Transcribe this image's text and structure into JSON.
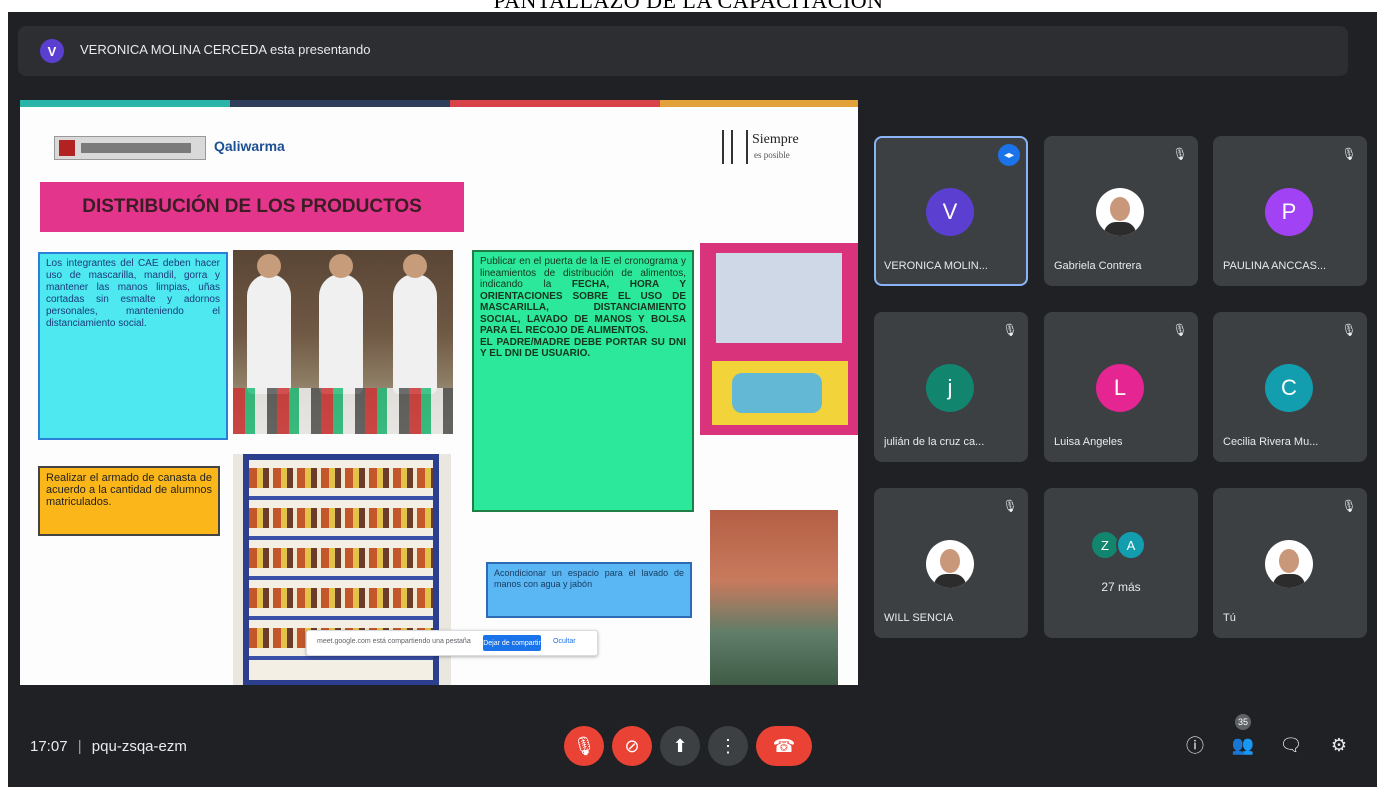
{
  "document": {
    "caption": "PANTALLAZO DE LA CAPACITACION"
  },
  "presenter": {
    "initial": "V",
    "text": "VERONICA MOLINA CERCEDA esta presentando"
  },
  "slide": {
    "stripe_colors": [
      "#2bb5a8",
      "#2f3e5a",
      "#d8434a",
      "#e3a13a"
    ],
    "logo_left_text": "Qaliwarma",
    "logo_right_text": "Siempre",
    "logo_right_sub": "es posible",
    "title": "DISTRIBUCIÓN DE LOS PRODUCTOS",
    "cyan_text": "Los integrantes del CAE deben hacer uso de mascarilla, mandil, gorra y mantener las manos limpias, uñas cortadas sin esmalte y adornos personales, manteniendo el distanciamiento social.",
    "orange_text": "Realizar el armado de canasta de acuerdo a la cantidad de alumnos matriculados.",
    "green_parts": {
      "p1": "Publicar en el puerta de la IE el cronograma y lineamientos de distribución de alimentos, indicando la ",
      "b1": "FECHA, HORA Y ORIENTACIONES SOBRE EL USO DE MASCARILLA, DISTANCIAMIENTO SOCIAL, LAVADO DE MANOS Y BOLSA PARA EL RECOJO DE ALIMENTOS.",
      "b2": "EL PADRE/MADRE DEBE PORTAR SU DNI Y EL DNI DE USUARIO."
    },
    "blue_text": "Acondicionar un espacio para el lavado de manos con agua y jabón",
    "share_popup": {
      "message": "meet.google.com está compartiendo una pestaña",
      "stop_label": "Dejar de compartir",
      "hide_label": "Ocultar"
    }
  },
  "participants": [
    {
      "name": "VERONICA MOLIN...",
      "initial": "V",
      "color": "#5b3fd1",
      "type": "initial",
      "active": true
    },
    {
      "name": "Gabriela Contrera",
      "initial": "",
      "color": "",
      "type": "photo",
      "active": false
    },
    {
      "name": "PAULINA ANCCAS...",
      "initial": "P",
      "color": "#a142f4",
      "type": "initial",
      "active": false
    },
    {
      "name": "julián de la cruz ca...",
      "initial": "j",
      "color": "#12856f",
      "type": "initial",
      "active": false
    },
    {
      "name": "Luisa Angeles",
      "initial": "L",
      "color": "#e52592",
      "type": "initial",
      "active": false
    },
    {
      "name": "Cecilia Rivera Mu...",
      "initial": "C",
      "color": "#129eaf",
      "type": "initial",
      "active": false
    },
    {
      "name": "WILL SENCIA",
      "initial": "",
      "color": "",
      "type": "photo",
      "active": false
    },
    {
      "name": "",
      "initial": "",
      "color": "",
      "type": "more",
      "active": false
    },
    {
      "name": "Tú",
      "initial": "",
      "color": "",
      "type": "photo",
      "active": false
    }
  ],
  "more": {
    "a": "Z",
    "b": "A",
    "label": "27 más"
  },
  "bottom": {
    "time": "17:07",
    "separator": "|",
    "meeting_code": "pqu-zsqa-ezm",
    "people_count": "35"
  },
  "icons": {
    "mic_off": "🎙",
    "cam_off": "⊘",
    "present": "⬆",
    "more": "⋮",
    "hangup": "☎",
    "info": "ⓘ",
    "people": "👥",
    "chat": "🗨",
    "activities": "⚙"
  },
  "colors": {
    "meet_bg": "#202124",
    "tile_bg": "#3c4043",
    "red": "#ea4335",
    "accent": "#8ab4f8"
  }
}
